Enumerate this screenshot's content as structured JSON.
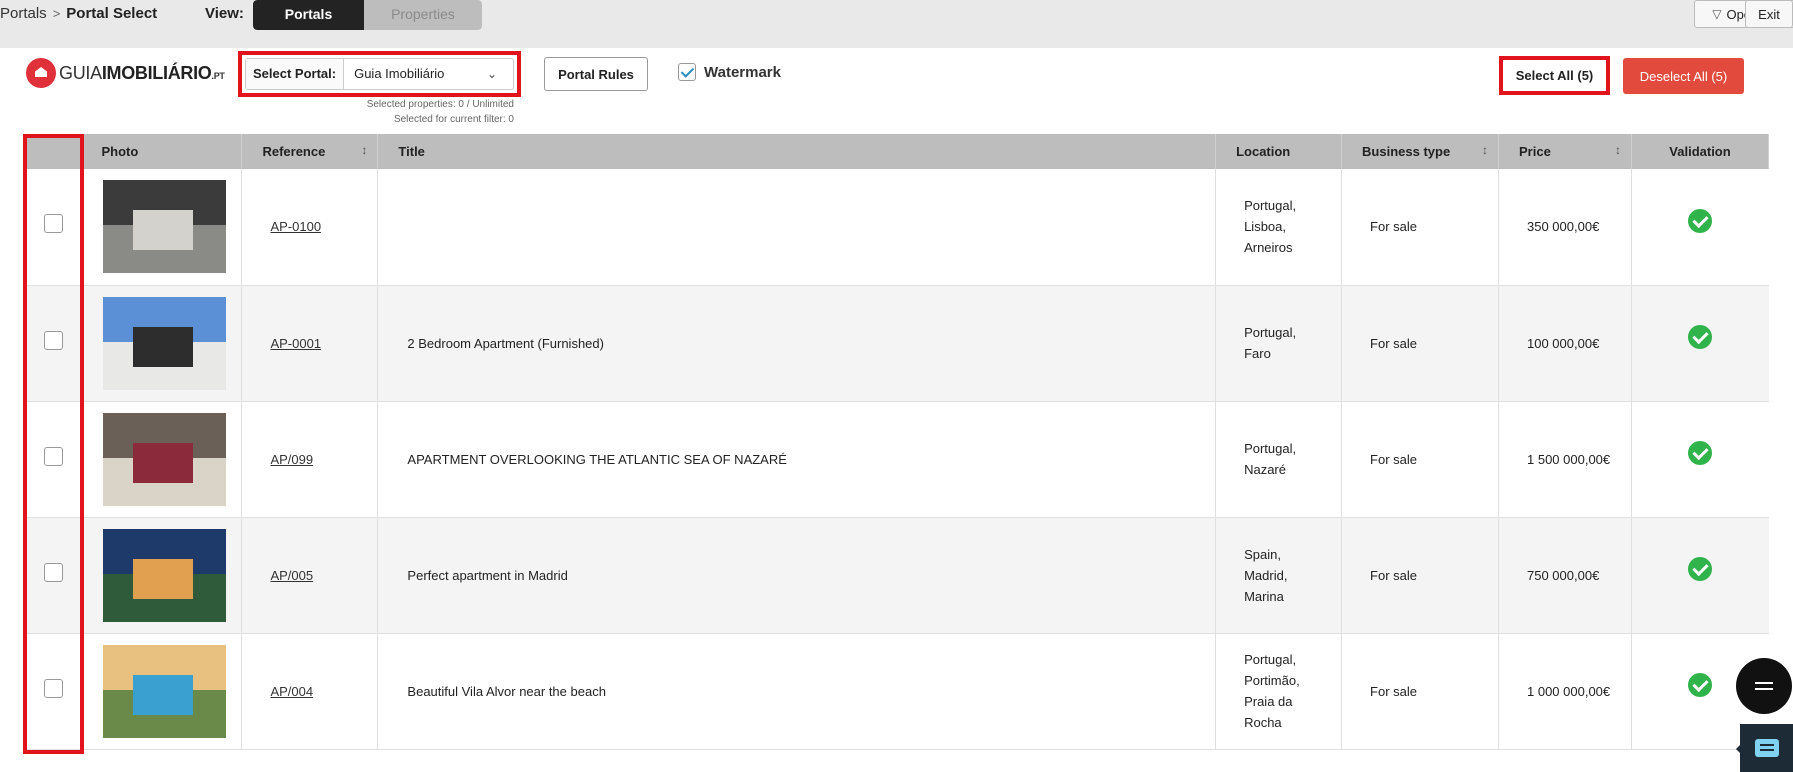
{
  "breadcrumb": {
    "parent": "Portals",
    "current": "Portal Select"
  },
  "view": {
    "label": "View:",
    "options": [
      "Portals",
      "Properties"
    ],
    "active": "Portals"
  },
  "topbar_buttons": {
    "open_filter": "Open Filter",
    "exit": "Exit"
  },
  "logo": {
    "part1": "GUIA",
    "part2": "IMOBILIÁRIO",
    "suffix": ".PT"
  },
  "portal_select": {
    "label": "Select Portal:",
    "value": "Guia Imobiliário",
    "selected_properties": "Selected properties: 0 / Unlimited",
    "selected_filter": "Selected for current filter: 0"
  },
  "actions": {
    "portal_rules": "Portal Rules",
    "watermark": "Watermark",
    "watermark_checked": true,
    "select_all": "Select All (5)",
    "deselect_all": "Deselect All (5)"
  },
  "table": {
    "headers": [
      "",
      "Photo",
      "Reference",
      "Title",
      "Location",
      "Business type",
      "Price",
      "Validation"
    ],
    "rows": [
      {
        "reference": "AP-0100",
        "title": "",
        "location": [
          "Portugal,",
          "Lisboa,",
          "Arneiros"
        ],
        "business": "For sale",
        "price": "350 000,00€",
        "validated": true,
        "photo_colors": [
          "#3b3b3b",
          "#8a8a86",
          "#d4d2cc"
        ]
      },
      {
        "reference": "AP-0001",
        "title": "2 Bedroom Apartment (Furnished)",
        "location": [
          "Portugal,",
          "Faro"
        ],
        "business": "For sale",
        "price": "100 000,00€",
        "validated": true,
        "photo_colors": [
          "#5b8fd6",
          "#e8e8e6",
          "#2d2d2d"
        ]
      },
      {
        "reference": "AP/099",
        "title": "APARTMENT OVERLOOKING THE ATLANTIC SEA OF NAZARÉ",
        "location": [
          "Portugal,",
          "Nazaré"
        ],
        "business": "For sale",
        "price": "1 500 000,00€",
        "validated": true,
        "photo_colors": [
          "#6a6058",
          "#d9d3c8",
          "#8a2a3a"
        ]
      },
      {
        "reference": "AP/005",
        "title": "Perfect apartment in Madrid",
        "location": [
          "Spain,",
          "Madrid,",
          "Marina"
        ],
        "business": "For sale",
        "price": "750 000,00€",
        "validated": true,
        "photo_colors": [
          "#1e3a6a",
          "#2f5b3a",
          "#e0a050"
        ]
      },
      {
        "reference": "AP/004",
        "title": "Beautiful Vila Alvor near the beach",
        "location": [
          "Portugal,",
          "Portimão,",
          "Praia da",
          "Rocha"
        ],
        "business": "For sale",
        "price": "1 000 000,00€",
        "validated": true,
        "photo_colors": [
          "#e8c080",
          "#6a8a4a",
          "#3aa0d0"
        ]
      }
    ]
  },
  "colors": {
    "highlight": "#e1141e",
    "deselect": "#e14a3c",
    "valid": "#2fb34a",
    "header": "#bdbdbd"
  }
}
